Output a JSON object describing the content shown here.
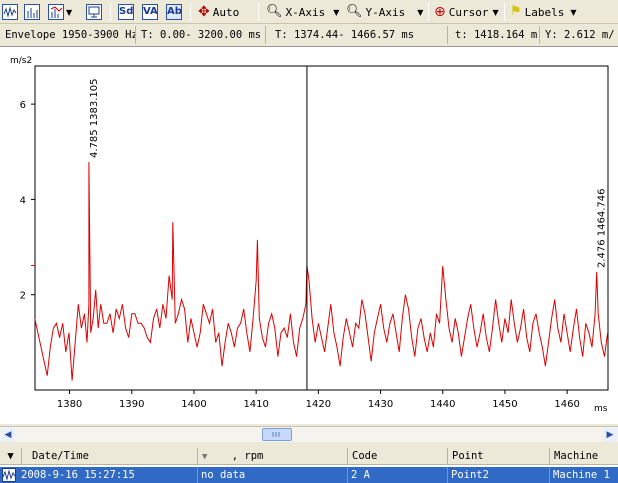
{
  "toolbar": {
    "auto_label": "Auto",
    "xaxis_label": "X-Axis",
    "yaxis_label": "Y-Axis",
    "cursor_label": "Cursor",
    "labels_label": "Labels",
    "sd_letters": "Sd",
    "va_letters": "VA",
    "ab_letters": "Ab"
  },
  "infobar": {
    "envelope": "Envelope 1950-3900 Hz",
    "time_range": "T: 0.00- 3200.00 ms",
    "visible_range": "T: 1374.44- 1466.57 ms",
    "cursor_t": "t: 1418.164 m",
    "cursor_y": "Y:  2.612 m/"
  },
  "chart_data": {
    "type": "line",
    "ylabel": "m/s2",
    "xlabel": "ms",
    "xlim": [
      1374.44,
      1466.57
    ],
    "ylim": [
      0,
      6.8
    ],
    "xticks": [
      1380,
      1390,
      1400,
      1410,
      1420,
      1430,
      1440,
      1450,
      1460
    ],
    "yticks": [
      2,
      4,
      6
    ],
    "cursor_x": 1418.164,
    "series": [
      {
        "color": "#dd0000",
        "x": [
          1374.4,
          1374.9,
          1375.4,
          1375.9,
          1376.4,
          1376.9,
          1377.4,
          1377.9,
          1378.4,
          1378.9,
          1379.4,
          1379.9,
          1380.4,
          1380.9,
          1381.4,
          1381.9,
          1382.4,
          1382.8,
          1383.1,
          1383.4,
          1383.8,
          1384.2,
          1384.6,
          1385.0,
          1385.5,
          1386.0,
          1386.5,
          1387.0,
          1387.5,
          1388.0,
          1388.5,
          1389.0,
          1389.5,
          1390.0,
          1390.5,
          1391.0,
          1391.5,
          1392.0,
          1392.5,
          1393.0,
          1393.5,
          1394.0,
          1394.5,
          1395.0,
          1395.5,
          1396.0,
          1396.5,
          1397.0,
          1397.5,
          1398.0,
          1398.5,
          1399.0,
          1399.5,
          1400.0,
          1400.5,
          1401.0,
          1401.5,
          1402.0,
          1402.5,
          1403.0,
          1403.5,
          1404.0,
          1404.5,
          1405.0,
          1405.5,
          1406.0,
          1406.5,
          1407.0,
          1407.5,
          1408.0,
          1408.5,
          1409.0,
          1409.5,
          1410.0,
          1410.5,
          1411.0,
          1411.5,
          1412.0,
          1412.5,
          1413.0,
          1413.5,
          1414.0,
          1414.5,
          1415.0,
          1415.5,
          1416.0,
          1416.5,
          1417.0,
          1417.5,
          1418.0,
          1418.5,
          1419.0,
          1419.5,
          1420.0,
          1420.5,
          1421.0,
          1421.5,
          1422.0,
          1422.5,
          1423.0,
          1423.5,
          1424.0,
          1424.5,
          1425.0,
          1425.5,
          1426.0,
          1426.5,
          1427.0,
          1427.5,
          1428.0,
          1428.5,
          1429.0,
          1429.5,
          1430.0,
          1430.5,
          1431.0,
          1431.5,
          1432.0,
          1432.5,
          1433.0,
          1433.5,
          1434.0,
          1434.5,
          1435.0,
          1435.5,
          1436.0,
          1436.5,
          1437.0,
          1437.5,
          1438.0,
          1438.5,
          1439.0,
          1439.5,
          1440.0,
          1440.5,
          1441.0,
          1441.5,
          1442.0,
          1442.5,
          1443.0,
          1443.5,
          1444.0,
          1444.5,
          1445.0,
          1445.5,
          1446.0,
          1446.5,
          1447.0,
          1447.5,
          1448.0,
          1448.5,
          1449.0,
          1449.5,
          1450.0,
          1450.5,
          1451.0,
          1451.5,
          1452.0,
          1452.5,
          1453.0,
          1453.5,
          1454.0,
          1454.5,
          1455.0,
          1455.5,
          1456.0,
          1456.5,
          1457.0,
          1457.5,
          1458.0,
          1458.5,
          1459.0,
          1459.5,
          1460.0,
          1460.5,
          1461.0,
          1461.5,
          1462.0,
          1462.5,
          1463.0,
          1463.5,
          1464.0,
          1464.5,
          1464.75,
          1465.0,
          1465.5,
          1466.0,
          1466.5
        ],
        "y": [
          1.5,
          1.2,
          0.9,
          0.6,
          0.3,
          0.9,
          1.3,
          1.4,
          1.1,
          1.4,
          0.8,
          1.2,
          0.2,
          1.0,
          1.8,
          1.3,
          1.6,
          1.0,
          1.8,
          1.2,
          1.5,
          2.1,
          1.3,
          1.8,
          1.4,
          1.4,
          1.6,
          1.2,
          1.7,
          1.5,
          1.8,
          1.3,
          1.1,
          1.6,
          1.6,
          1.4,
          1.4,
          1.3,
          1.1,
          1.0,
          1.5,
          1.7,
          1.3,
          1.8,
          1.5,
          2.4,
          1.9,
          1.4,
          1.6,
          1.9,
          1.7,
          1.0,
          1.5,
          1.2,
          0.9,
          1.2,
          1.8,
          1.6,
          1.4,
          1.7,
          1.0,
          1.2,
          0.5,
          1.0,
          1.4,
          1.2,
          0.9,
          1.3,
          1.4,
          1.7,
          1.2,
          0.8,
          1.5,
          2.3,
          1.5,
          1.1,
          0.9,
          1.4,
          1.6,
          1.3,
          0.7,
          1.2,
          1.3,
          1.1,
          1.6,
          1.0,
          0.7,
          1.3,
          1.5,
          1.8,
          2.3,
          1.5,
          1.0,
          1.4,
          1.1,
          0.8,
          1.3,
          1.8,
          1.2,
          0.9,
          0.5,
          1.1,
          1.5,
          1.2,
          0.9,
          1.4,
          1.3,
          1.9,
          1.6,
          1.1,
          0.6,
          1.2,
          1.5,
          1.8,
          1.3,
          1.0,
          1.4,
          1.6,
          1.2,
          0.8,
          1.5,
          2.0,
          1.7,
          1.1,
          0.7,
          1.3,
          1.5,
          1.1,
          0.8,
          1.2,
          0.9,
          1.6,
          1.4,
          2.6,
          1.9,
          1.3,
          1.0,
          1.5,
          1.2,
          0.7,
          1.1,
          1.5,
          1.8,
          1.3,
          0.9,
          1.2,
          1.6,
          1.1,
          0.8,
          1.3,
          1.9,
          1.4,
          1.0,
          1.5,
          1.2,
          1.9,
          1.4,
          1.0,
          1.3,
          1.7,
          1.1,
          0.8,
          1.4,
          1.6,
          1.2,
          0.9,
          0.5,
          1.0,
          1.5,
          1.9,
          1.3,
          1.0,
          1.6,
          1.2,
          0.8,
          1.3,
          1.7,
          1.1,
          0.7,
          1.4,
          1.2,
          0.9,
          1.6,
          2.476,
          1.6,
          1.0,
          0.7,
          1.2
        ],
        "peaks": [
          {
            "x": 1383.105,
            "y": 4.785
          },
          {
            "x": 1396.6,
            "y": 3.52
          },
          {
            "x": 1410.2,
            "y": 3.15
          },
          {
            "x": 1418.164,
            "y": 2.612
          },
          {
            "x": 1464.746,
            "y": 2.476
          }
        ]
      }
    ],
    "annotations": [
      {
        "text": "4.785  1383.105",
        "x": 1383.105,
        "y": 4.785
      },
      {
        "text": "2.476  1464.746",
        "x": 1464.746,
        "y": 2.476
      }
    ]
  },
  "grid": {
    "columns": [
      {
        "label": "Date/Time"
      },
      {
        "label": ", rpm"
      },
      {
        "label": "Code"
      },
      {
        "label": "Point"
      },
      {
        "label": "Machine"
      }
    ],
    "row": {
      "datetime": "2008-9-16 15:27:15",
      "rpm": "no data",
      "code": "2 A",
      "point": "Point2",
      "machine": "Machine 1"
    }
  }
}
